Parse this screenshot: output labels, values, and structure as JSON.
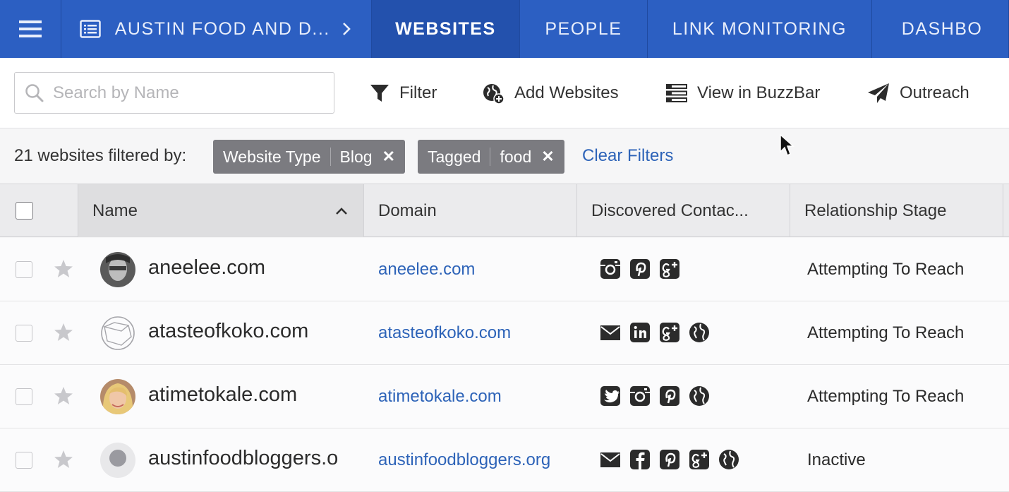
{
  "nav": {
    "menu_icon": "hamburger-icon",
    "project_icon": "list-icon",
    "project_label": "AUSTIN FOOD AND D...",
    "tabs": [
      {
        "label": "WEBSITES",
        "active": true
      },
      {
        "label": "PEOPLE",
        "active": false
      },
      {
        "label": "LINK MONITORING",
        "active": false
      },
      {
        "label": "DASHBO",
        "active": false
      }
    ]
  },
  "toolbar": {
    "search_placeholder": "Search by Name",
    "filter_label": "Filter",
    "add_websites_label": "Add Websites",
    "buzzbar_label": "View in BuzzBar",
    "outreach_label": "Outreach"
  },
  "filters": {
    "summary": "21 websites filtered by:",
    "chips": [
      {
        "key": "Website Type",
        "value": "Blog"
      },
      {
        "key": "Tagged",
        "value": "food"
      }
    ],
    "clear_label": "Clear Filters"
  },
  "table": {
    "columns": [
      "Name",
      "Domain",
      "Discovered Contac...",
      "Relationship Stage"
    ],
    "sort_column": "Name",
    "sort_direction": "ascending",
    "rows": [
      {
        "name": "aneelee.com",
        "domain": "aneelee.com",
        "avatar": "photo-grayscale",
        "contacts": [
          "instagram-icon",
          "pinterest-icon",
          "google-plus-icon"
        ],
        "stage": "Attempting To Reach"
      },
      {
        "name": "atasteofkoko.com",
        "domain": "atasteofkoko.com",
        "avatar": "globe-placeholder",
        "contacts": [
          "email-icon",
          "linkedin-icon",
          "google-plus-icon",
          "globe-icon"
        ],
        "stage": "Attempting To Reach"
      },
      {
        "name": "atimetokale.com",
        "domain": "atimetokale.com",
        "avatar": "photo-blonde",
        "contacts": [
          "twitter-icon",
          "instagram-icon",
          "pinterest-icon",
          "globe-icon"
        ],
        "stage": "Attempting To Reach"
      },
      {
        "name": "austinfoodbloggers.o",
        "domain": "austinfoodbloggers.org",
        "avatar": "photo-partial",
        "contacts": [
          "email-icon",
          "facebook-icon",
          "pinterest-icon",
          "google-plus-icon",
          "globe-icon"
        ],
        "stage": "Inactive"
      }
    ]
  },
  "colors": {
    "nav_bg": "#2c5fc2",
    "nav_active": "#2351ad",
    "link": "#2d63b8",
    "chip_bg": "#7b7b80"
  }
}
